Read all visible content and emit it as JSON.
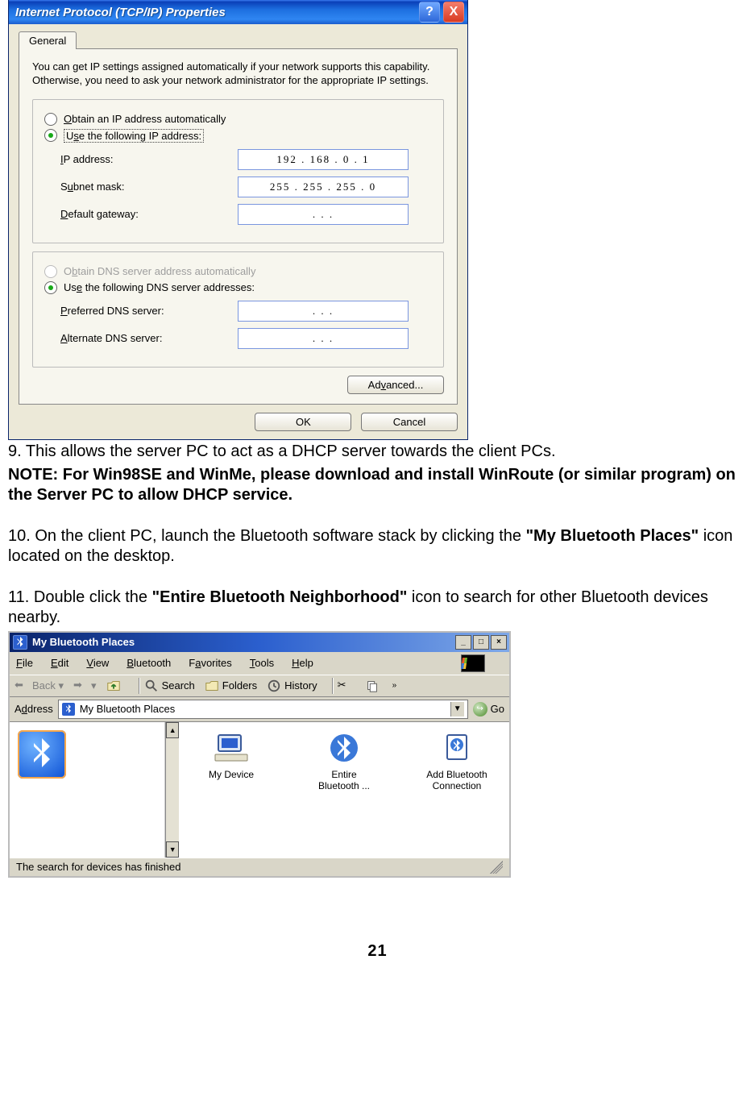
{
  "tcpip": {
    "title": "Internet Protocol (TCP/IP) Properties",
    "tab": "General",
    "description": "You can get IP settings assigned automatically if your network supports this capability. Otherwise, you need to ask your network administrator for the appropriate IP settings.",
    "radio_auto_ip": "Obtain an IP address automatically",
    "radio_use_ip": "Use the following IP address:",
    "ip_label": "IP address:",
    "ip_value": "192 . 168 .   0  .   1",
    "subnet_label": "Subnet mask:",
    "subnet_value": "255 . 255 . 255 .   0",
    "gateway_label": "Default gateway:",
    "gateway_value": ".        .        .",
    "radio_auto_dns": "Obtain DNS server address automatically",
    "radio_use_dns": "Use the following DNS server addresses:",
    "pref_dns_label": "Preferred DNS server:",
    "pref_dns_value": ".       .       .",
    "alt_dns_label": "Alternate DNS server:",
    "alt_dns_value": ".       .       .",
    "advanced_btn": "Advanced...",
    "ok_btn": "OK",
    "cancel_btn": "Cancel"
  },
  "doc": {
    "p9": "9. This allows the server PC to act as a DHCP server towards the client PCs.",
    "note": "NOTE: For Win98SE and WinMe, please download and install WinRoute (or similar program) on the Server PC to allow DHCP service.",
    "p10_a": "10. On the client PC, launch the Bluetooth software stack by clicking the ",
    "p10_b": "\"My Bluetooth Places\"",
    "p10_c": " icon located on the desktop.",
    "p11_a": "11. Double click the ",
    "p11_b": "\"Entire Bluetooth Neighborhood\"",
    "p11_c": " icon to search for other Bluetooth devices nearby.",
    "page_num": "21"
  },
  "btwin": {
    "title": "My Bluetooth Places",
    "menu": {
      "file": "File",
      "edit": "Edit",
      "view": "View",
      "bluetooth": "Bluetooth",
      "favorites": "Favorites",
      "tools": "Tools",
      "help": "Help"
    },
    "tb": {
      "back": "Back",
      "search": "Search",
      "folders": "Folders",
      "history": "History"
    },
    "addr_label": "Address",
    "addr_value": "My Bluetooth Places",
    "go": "Go",
    "icons": {
      "mydevice": "My Device",
      "entire_l1": "Entire",
      "entire_l2": "Bluetooth ...",
      "addconn_l1": "Add Bluetooth",
      "addconn_l2": "Connection"
    },
    "status": "The search for devices has finished"
  }
}
